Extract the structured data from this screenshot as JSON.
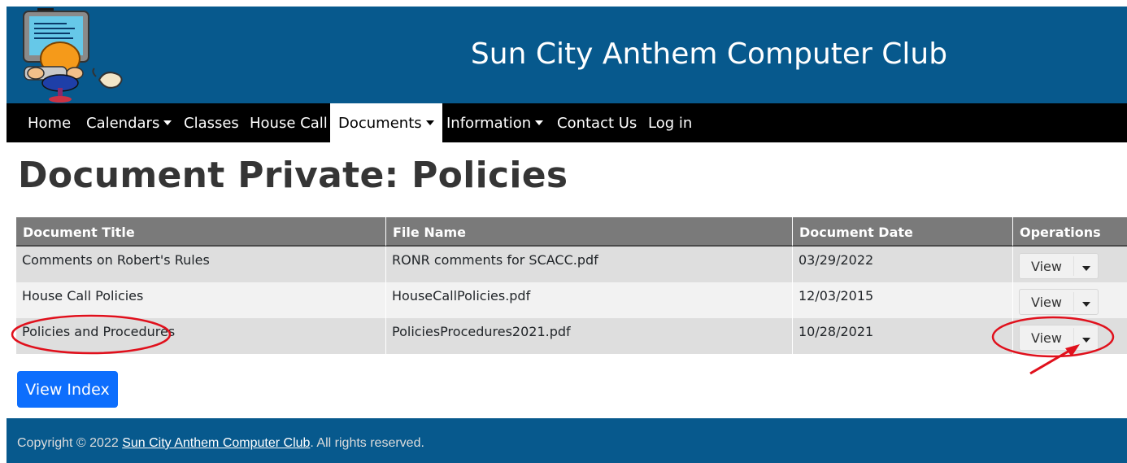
{
  "site": {
    "title": "Sun City Anthem Computer Club"
  },
  "nav": {
    "items": [
      {
        "label": "Home",
        "dropdown": false
      },
      {
        "label": "Calendars",
        "dropdown": true
      },
      {
        "label": "Classes",
        "dropdown": false
      },
      {
        "label": "House Call",
        "dropdown": false
      },
      {
        "label": "Documents",
        "dropdown": true,
        "active": true
      },
      {
        "label": "Information",
        "dropdown": true
      },
      {
        "label": "Contact Us",
        "dropdown": false
      },
      {
        "label": "Log in",
        "dropdown": false
      }
    ]
  },
  "page": {
    "title": "Document Private: Policies"
  },
  "table": {
    "headers": [
      "Document Title",
      "File Name",
      "Document Date",
      "Operations"
    ],
    "rows": [
      {
        "title": "Comments on Robert's Rules",
        "file": "RONR comments for SCACC.pdf",
        "date": "03/29/2022",
        "op": "View"
      },
      {
        "title": "House Call Policies",
        "file": "HouseCallPolicies.pdf",
        "date": "12/03/2015",
        "op": "View"
      },
      {
        "title": "Policies and Procedures",
        "file": "PoliciesProcedures2021.pdf",
        "date": "10/28/2021",
        "op": "View"
      }
    ]
  },
  "buttons": {
    "view_index": "View Index"
  },
  "footer": {
    "prefix": "Copyright © 2022",
    "link": "Sun City Anthem Computer Club",
    "suffix": ". All rights reserved."
  },
  "colors": {
    "header_bg": "#07598d",
    "nav_bg": "#000000",
    "primary_button": "#0d6efd",
    "annotation": "#e0101c"
  }
}
